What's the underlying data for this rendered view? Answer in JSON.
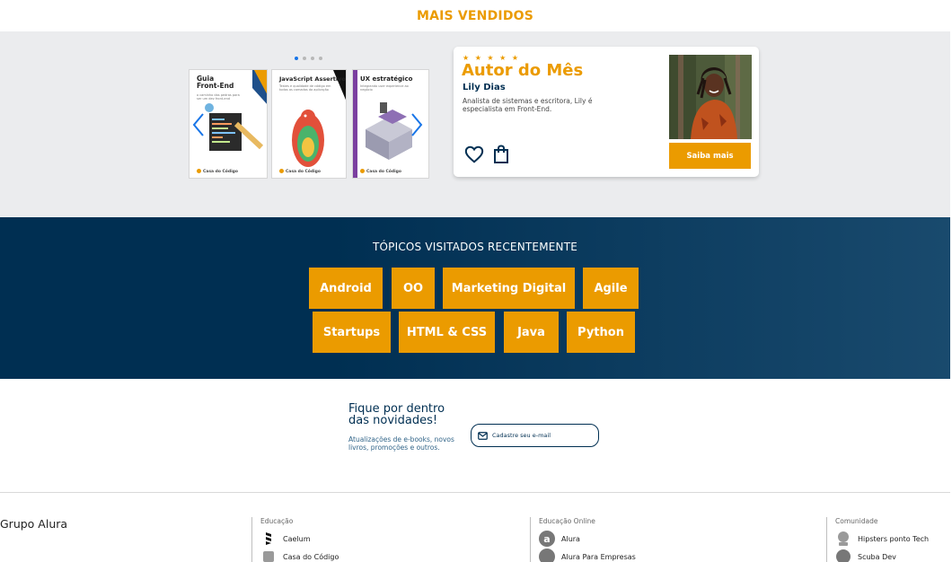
{
  "best_sellers": {
    "title": "MAIS VENDIDOS",
    "books": [
      {
        "title_line1": "Guia",
        "title_line2": "Front-End",
        "subtitle": "o caminho das pedras para ser um dev front-end",
        "publisher": "Casa do Código"
      },
      {
        "title_line1": "JavaScript Assertivo",
        "title_line2": "",
        "subtitle": "Testes e qualidade de código em todas as camadas da aplicação",
        "publisher": "Casa do Código"
      },
      {
        "title_line1": "UX estratégico",
        "title_line2": "",
        "subtitle": "Integrando user experience ao negócio",
        "publisher": "Casa do Código"
      }
    ]
  },
  "author_of_month": {
    "stars": "★ ★ ★ ★ ★",
    "title": "Autor do Mês",
    "name": "Lily Dias",
    "description": "Analista de sistemas e escritora, Lily é especialista em Front-End.",
    "button_label": "Saiba mais"
  },
  "topics": {
    "title": "TÓPICOS VISITADOS RECENTEMENTE",
    "items": [
      "Android",
      "OO",
      "Marketing Digital",
      "Agile",
      "Startups",
      "HTML & CSS",
      "Java",
      "Python"
    ]
  },
  "newsletter": {
    "title_line1": "Fique por dentro",
    "title_line2": "das novidades!",
    "subtitle": "Atualizações de e-books, novos livros, promoções e outros.",
    "email_placeholder": "Cadastre seu e-mail"
  },
  "footer": {
    "brand": "Grupo Alura",
    "columns": [
      {
        "title": "Educação",
        "items": [
          "Caelum",
          "Casa do Código"
        ]
      },
      {
        "title": "Educação Online",
        "items": [
          "Alura",
          "Alura Para Empresas"
        ]
      },
      {
        "title": "Comunidade",
        "items": [
          "Hipsters ponto Tech",
          "Scuba Dev"
        ]
      }
    ]
  },
  "colors": {
    "accent": "#EB9B00",
    "navy": "#002F52",
    "band": "#EBECEE",
    "dot_active": "#1875E8"
  }
}
